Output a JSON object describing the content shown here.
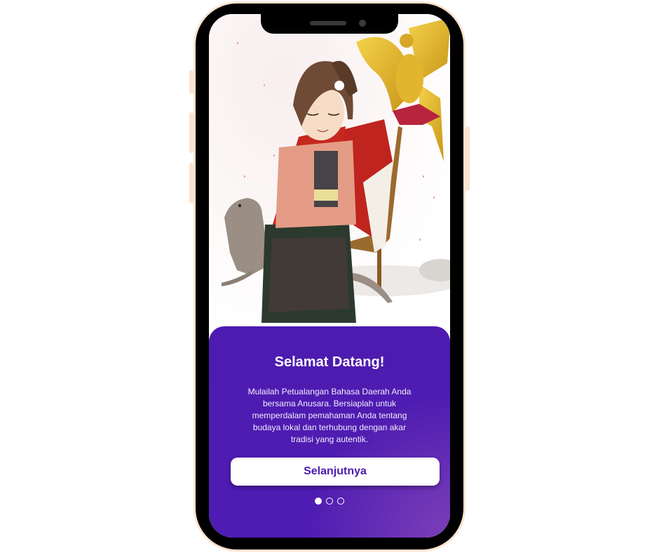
{
  "onboarding": {
    "title": "Selamat Datang!",
    "description": "Mulailah Petualangan Bahasa Daerah Anda bersama Anusara. Bersiaplah untuk memperdalam pemahaman Anda tentang budaya lokal dan terhubung dengan akar tradisi yang autentik.",
    "next_label": "Selanjutnya",
    "pagination": {
      "total": 3,
      "active": 1
    }
  },
  "illustration": {
    "subjects": [
      "girl-in-batik",
      "komodo-dragon",
      "golden-garuda",
      "red-white-flag",
      "wooden-chair"
    ]
  },
  "colors": {
    "primary": "#4d1bb0",
    "accent_glow": "#7c3fb8",
    "button_bg": "#ffffff",
    "phone_frame": "#000000",
    "phone_outline": "#fbe3cf"
  }
}
